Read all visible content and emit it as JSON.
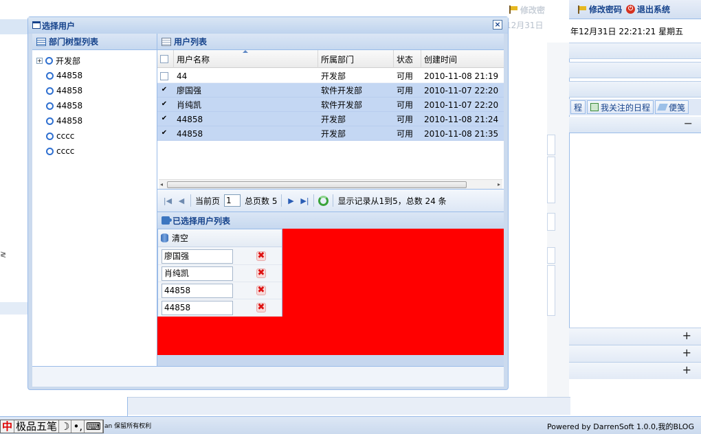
{
  "background": {
    "faded_change_pwd": "修改密",
    "toolbar": {
      "change_password": "修改密码",
      "logout": "退出系统"
    },
    "faded_date": "12月31日",
    "datetime": "年12月31日 22:21:21 星期五",
    "tabs": [
      {
        "label": "程"
      },
      {
        "label": "我关注的日程"
      },
      {
        "label": "便笺"
      }
    ],
    "left_cut_text": "≷",
    "footer_right": "Powered by DarrenSoft 1.0.0,我的BLOG",
    "footer_left": "an 保留所有权利",
    "ime": {
      "name": "极品五笔",
      "mark1": "中",
      "mark2": "•,",
      "mark3": "⌨"
    }
  },
  "window": {
    "title": "选择用户",
    "close_icon": "×",
    "dept_tree": {
      "title": "部门树型列表",
      "root": {
        "expander": "+",
        "label": "开发部"
      },
      "children": [
        "44858",
        "44858",
        "44858",
        "44858",
        "cccc",
        "cccc"
      ]
    },
    "user_list": {
      "title": "用户列表",
      "columns": [
        "用户名称",
        "所属部门",
        "状态",
        "创建时间"
      ],
      "rows": [
        {
          "checked": "",
          "name": "44",
          "dept": "开发部",
          "status": "可用",
          "created": "2010-11-08 21:19",
          "selected": false
        },
        {
          "checked": "✔",
          "name": "廖国强",
          "dept": "软件开发部",
          "status": "可用",
          "created": "2010-11-07 22:20",
          "selected": true
        },
        {
          "checked": "✔",
          "name": "肖纯凯",
          "dept": "软件开发部",
          "status": "可用",
          "created": "2010-11-07 22:20",
          "selected": true
        },
        {
          "checked": "✔",
          "name": "44858",
          "dept": "开发部",
          "status": "可用",
          "created": "2010-11-08 21:24",
          "selected": true
        },
        {
          "checked": "✔",
          "name": "44858",
          "dept": "开发部",
          "status": "可用",
          "created": "2010-11-08 21:35",
          "selected": true
        }
      ],
      "scroll_left": "◂",
      "scroll_right": "▸",
      "pager": {
        "first": "|◀",
        "prev": "◀",
        "current_label": "当前页",
        "current_page": "1",
        "total_label": "总页数 5",
        "next": "▶",
        "last": "▶|",
        "info": "显示记录从1到5，总数 24 条"
      }
    },
    "selected_panel": {
      "title": "已选择用户列表",
      "clear_label": "清空",
      "delete_glyph": "✖",
      "items": [
        "廖国强",
        "肖纯凯",
        "44858",
        "44858"
      ]
    }
  },
  "colors": {
    "accent": "#15428b",
    "border": "#99bbe8",
    "selection": "#c4d7f3",
    "red_area": "#ff0000"
  }
}
